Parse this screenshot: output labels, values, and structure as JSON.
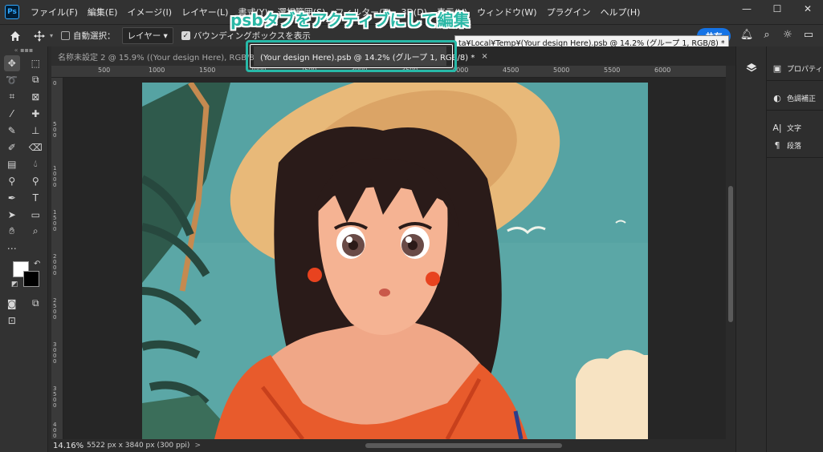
{
  "app": {
    "logo": "Ps"
  },
  "menu": [
    "ファイル(F)",
    "編集(E)",
    "イメージ(I)",
    "レイヤー(L)",
    "書式(Y)",
    "選択範囲(S)",
    "フィルター(T)",
    "3D(D)",
    "表示(V)",
    "ウィンドウ(W)",
    "プラグイン",
    "ヘルプ(H)"
  ],
  "window_controls": {
    "minimize": "—",
    "maximize": "☐",
    "close": "✕"
  },
  "options": {
    "home_icon": "home-icon",
    "move_icon": "move-icon",
    "auto_select_label": "自動選択：",
    "layer_select": "レイヤー",
    "bounding_box_label": "バウンディングボックスを表示",
    "share_label": "共有"
  },
  "tooltip": "ta¥Local¥Temp¥(Your design Here).psb @ 14.2% (グループ 1, RGB/8) *",
  "annotation": "psbタブをアクティブにして編集",
  "tabs": [
    {
      "label": "名称未設定 2 @ 15.9% ((Your design Here), RGB/8) *",
      "close": "×",
      "active": false
    },
    {
      "label": "(Your design Here).psb @ 14.2% (グループ 1, RGB/8) *",
      "close": "×",
      "active": true
    }
  ],
  "ruler_top": [
    "500",
    "1000",
    "1500",
    "2000",
    "2500",
    "3000",
    "3500",
    "4000",
    "4500",
    "5000",
    "5500",
    "6000"
  ],
  "ruler_left": [
    "0",
    "500",
    "1000",
    "1500",
    "2000",
    "2500",
    "3000",
    "3500",
    "4000"
  ],
  "status": {
    "zoom": "14.16%",
    "doc_info": "5522 px x 3840 px (300 ppi)",
    "arrow": ">"
  },
  "panels": [
    [
      {
        "label": "プロパティ",
        "icon": "properties-icon"
      }
    ],
    [
      {
        "label": "色調補正",
        "icon": "adjustments-icon"
      }
    ],
    [
      {
        "label": "文字",
        "icon": "character-icon"
      },
      {
        "label": "段落",
        "icon": "paragraph-icon"
      }
    ]
  ],
  "colors": {
    "accent": "#27b9a8",
    "share": "#1473e6",
    "foreground": "#ffffff",
    "background": "#000000"
  }
}
